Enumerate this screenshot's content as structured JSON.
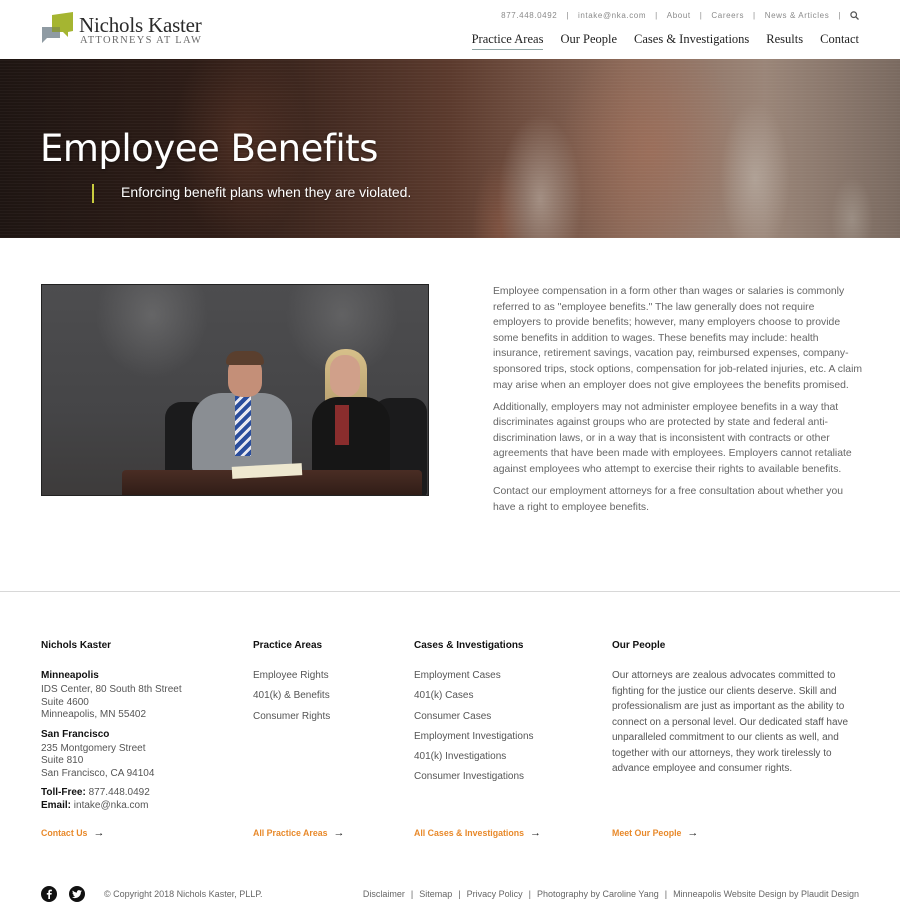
{
  "brand": {
    "name": "Nichols Kaster",
    "tagline": "ATTORNEYS AT LAW",
    "logo_colors": {
      "front_bubble": "#a5b531",
      "back_bubble": "#8f9ba3"
    }
  },
  "utility_nav": {
    "phone": "877.448.0492",
    "email": "intake@nka.com",
    "items": [
      "About",
      "Careers",
      "News & Articles"
    ],
    "separator": "|",
    "search_icon": "search-icon"
  },
  "main_nav": {
    "items": [
      {
        "label": "Practice Areas",
        "active": true
      },
      {
        "label": "Our People",
        "active": false
      },
      {
        "label": "Cases & Investigations",
        "active": false
      },
      {
        "label": "Results",
        "active": false
      },
      {
        "label": "Contact",
        "active": false
      }
    ]
  },
  "hero": {
    "title": "Employee Benefits",
    "subtitle": "Enforcing benefit plans when they are violated.",
    "accent_color": "#c9cc3f"
  },
  "content": {
    "image_alt": "Attorneys reviewing a document at a conference table",
    "paragraphs": [
      "Employee compensation in a form other than wages or salaries is commonly referred to as \"employee benefits.\" The law generally does not require employers to provide benefits; however, many employers choose to provide some benefits in addition to wages. These benefits may include: health insurance, retirement savings, vacation pay, reimbursed expenses, company-sponsored trips, stock options, compensation for job-related injuries, etc. A claim may arise when an employer does not give employees the benefits promised.",
      "Additionally, employers may not administer employee benefits in a way that discriminates against groups who are protected by state and federal anti-discrimination laws, or in a way that is inconsistent with contracts or other agreements that have been made with employees. Employers cannot retaliate against employees who attempt to exercise their rights to available benefits.",
      "Contact our employment attorneys for a free consultation about whether you have a right to employee benefits."
    ]
  },
  "footer": {
    "firm": {
      "heading": "Nichols Kaster",
      "offices": [
        {
          "name": "Minneapolis",
          "lines": [
            "IDS Center, 80 South 8th Street",
            "Suite 4600",
            "Minneapolis, MN 55402"
          ]
        },
        {
          "name": "San Francisco",
          "lines": [
            "235 Montgomery Street",
            "Suite 810",
            "San Francisco, CA 94104"
          ]
        }
      ],
      "tollfree_label": "Toll-Free:",
      "tollfree": "877.448.0492",
      "email_label": "Email:",
      "email": "intake@nka.com",
      "more_link": "Contact Us"
    },
    "practice_areas": {
      "heading": "Practice Areas",
      "items": [
        "Employee Rights",
        "401(k) & Benefits",
        "Consumer Rights"
      ],
      "more_link": "All Practice Areas"
    },
    "cases": {
      "heading": "Cases & Investigations",
      "items": [
        "Employment Cases",
        "401(k) Cases",
        "Consumer Cases",
        "Employment Investigations",
        "401(k) Investigations",
        "Consumer Investigations"
      ],
      "more_link": "All Cases & Investigations"
    },
    "people": {
      "heading": "Our People",
      "blurb": "Our attorneys are zealous advocates committed to fighting for the justice our clients deserve. Skill and professionalism are just as important as the ability to connect on a personal level. Our dedicated staff have unparalleled commitment to our clients as well, and together with our attorneys, they work tirelessly to advance employee and consumer rights.",
      "more_link": "Meet Our People"
    },
    "link_color": "#e8892a",
    "arrow": "→",
    "social": [
      "facebook-icon",
      "twitter-icon"
    ],
    "copyright": "© Copyright 2018 Nichols Kaster, PLLP.",
    "legal_links": [
      "Disclaimer",
      "Sitemap",
      "Privacy Policy",
      "Photography by Caroline Yang",
      "Minneapolis Website Design by Plaudit Design"
    ],
    "legal_separator": "|"
  }
}
